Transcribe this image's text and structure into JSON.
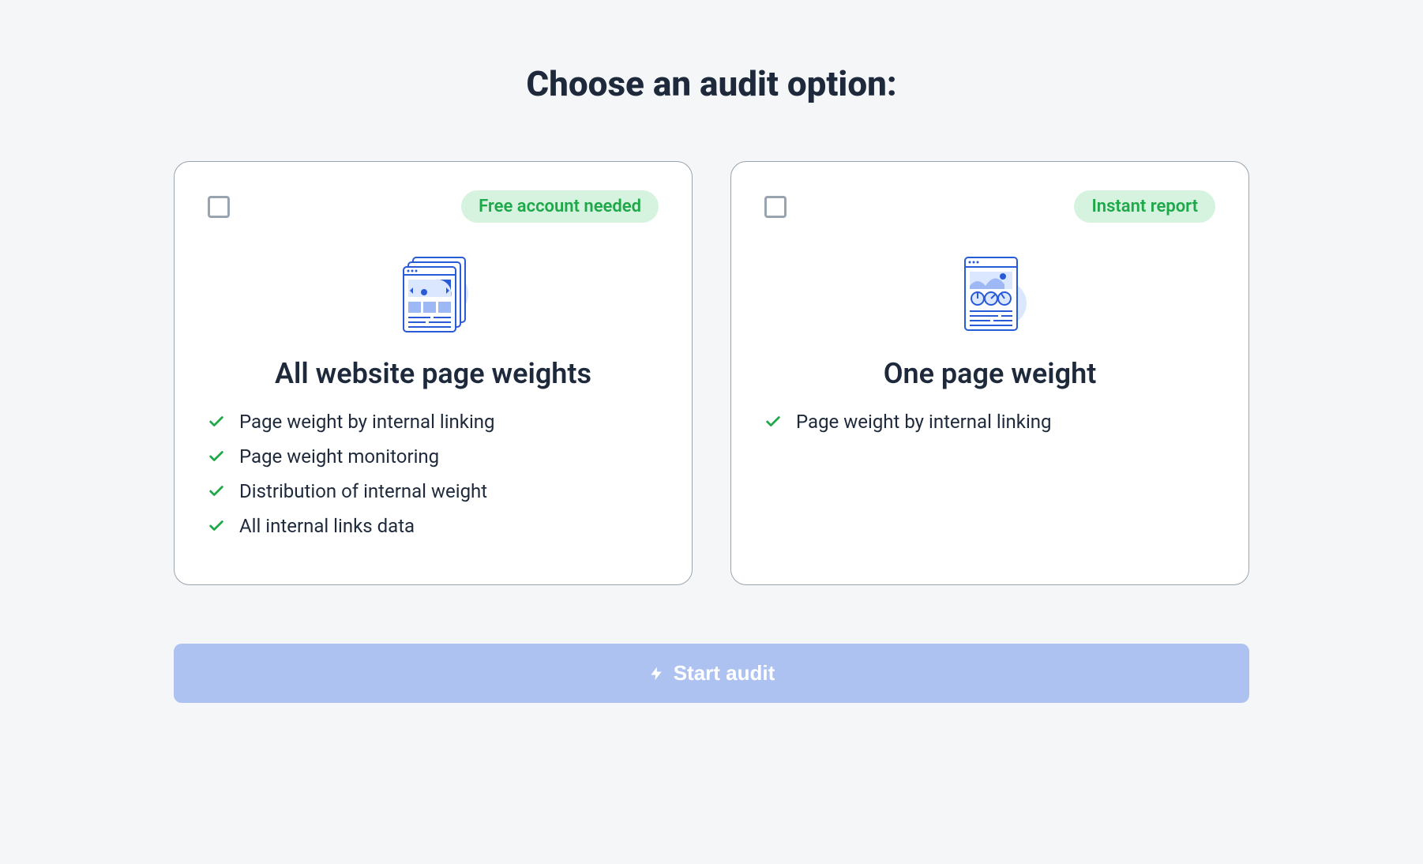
{
  "heading": "Choose an audit option:",
  "options": [
    {
      "badge": "Free account needed",
      "title": "All website page weights",
      "features": [
        "Page weight by internal linking",
        "Page weight monitoring",
        "Distribution of internal weight",
        "All internal links data"
      ]
    },
    {
      "badge": "Instant report",
      "title": "One page weight",
      "features": [
        "Page weight by internal linking"
      ]
    }
  ],
  "cta_label": "Start audit"
}
